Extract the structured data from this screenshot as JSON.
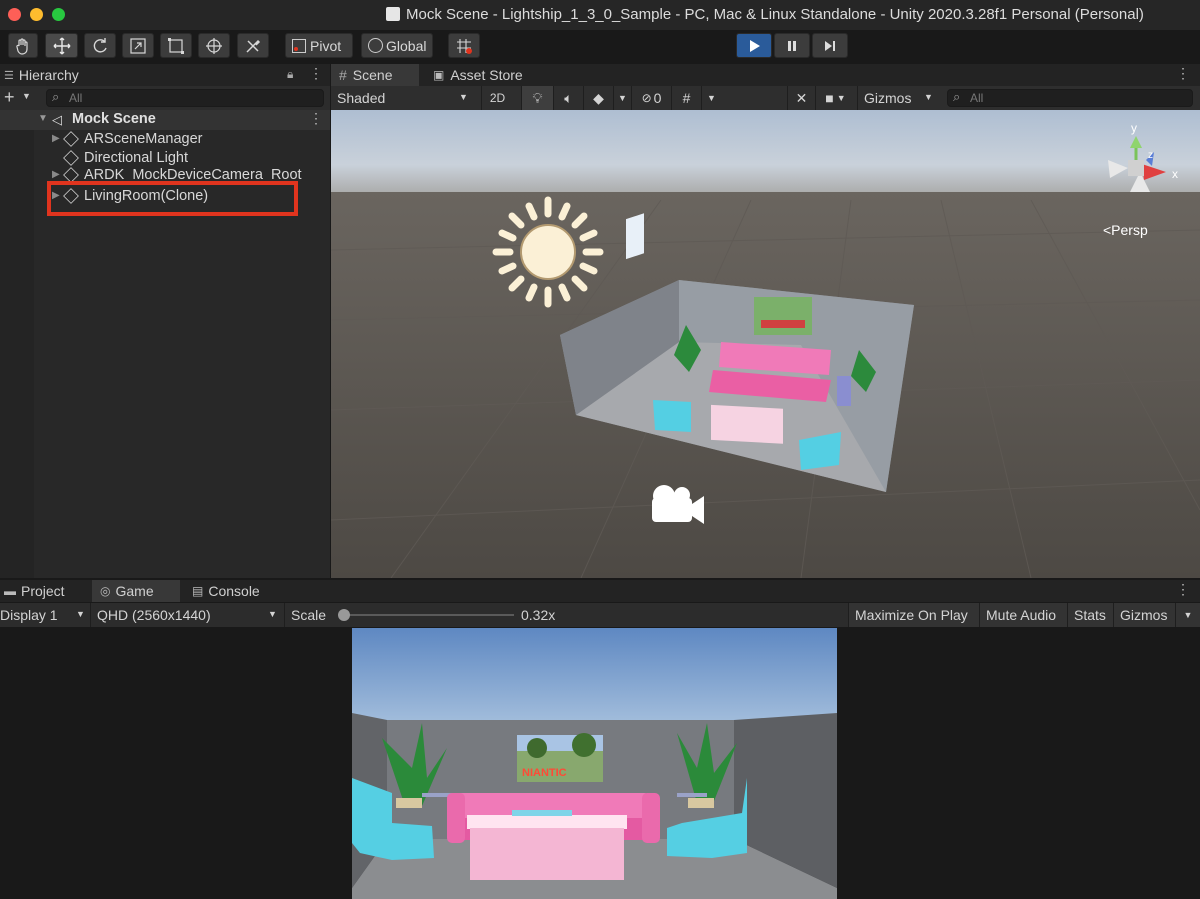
{
  "window": {
    "title": "Mock Scene - Lightship_1_3_0_Sample - PC, Mac & Linux Standalone - Unity 2020.3.28f1 Personal (Personal)",
    "traffic_colors": [
      "#fe5f57",
      "#febc2e",
      "#28c840"
    ]
  },
  "toolbar": {
    "pivot_label": "Pivot",
    "global_label": "Global",
    "tool_icons": [
      "hand-icon",
      "move-icon",
      "rotate-icon",
      "scale-icon",
      "rect-icon",
      "transform-icon",
      "custom-tool-icon"
    ]
  },
  "hierarchy": {
    "tab_label": "Hierarchy",
    "search_placeholder": "All",
    "scene_name": "Mock Scene",
    "items": [
      {
        "label": "ARSceneManager",
        "foldable": true
      },
      {
        "label": "Directional Light",
        "foldable": false
      },
      {
        "label": "ARDK_MockDeviceCamera_Root",
        "foldable": true
      },
      {
        "label": "LivingRoom(Clone)",
        "foldable": true,
        "highlighted": true
      }
    ],
    "highlight_color": "#e0341e"
  },
  "scene_view": {
    "tabs": [
      {
        "label": "Scene",
        "selected": true
      },
      {
        "label": "Asset Store",
        "selected": false
      }
    ],
    "shading_mode": "Shaded",
    "mode_2d_label": "2D",
    "hidden_count": "0",
    "gizmos_label": "Gizmos",
    "search_placeholder": "All",
    "persp_label": "<Persp",
    "gizmo_axes": {
      "x": "x",
      "y": "y",
      "z": "z"
    }
  },
  "bottom_panel": {
    "tabs": [
      {
        "label": "Project",
        "selected": false
      },
      {
        "label": "Game",
        "selected": true
      },
      {
        "label": "Console",
        "selected": false
      }
    ],
    "display": "Display 1",
    "resolution": "QHD (2560x1440)",
    "scale_label": "Scale",
    "scale_value": "0.32x",
    "scale_fraction": 0.02,
    "maximize_on_play": "Maximize On Play",
    "mute_audio": "Mute Audio",
    "stats": "Stats",
    "gizmos": "Gizmos"
  },
  "game_view": {
    "sign_text": "NIANTIC"
  },
  "colors": {
    "accent_play": "#2a5b9a",
    "sofa_pink": "#f07ab8",
    "chair_cyan": "#4fd3e6",
    "scene_sky": "#b7c6d8",
    "scene_ground": "#5c5752"
  }
}
